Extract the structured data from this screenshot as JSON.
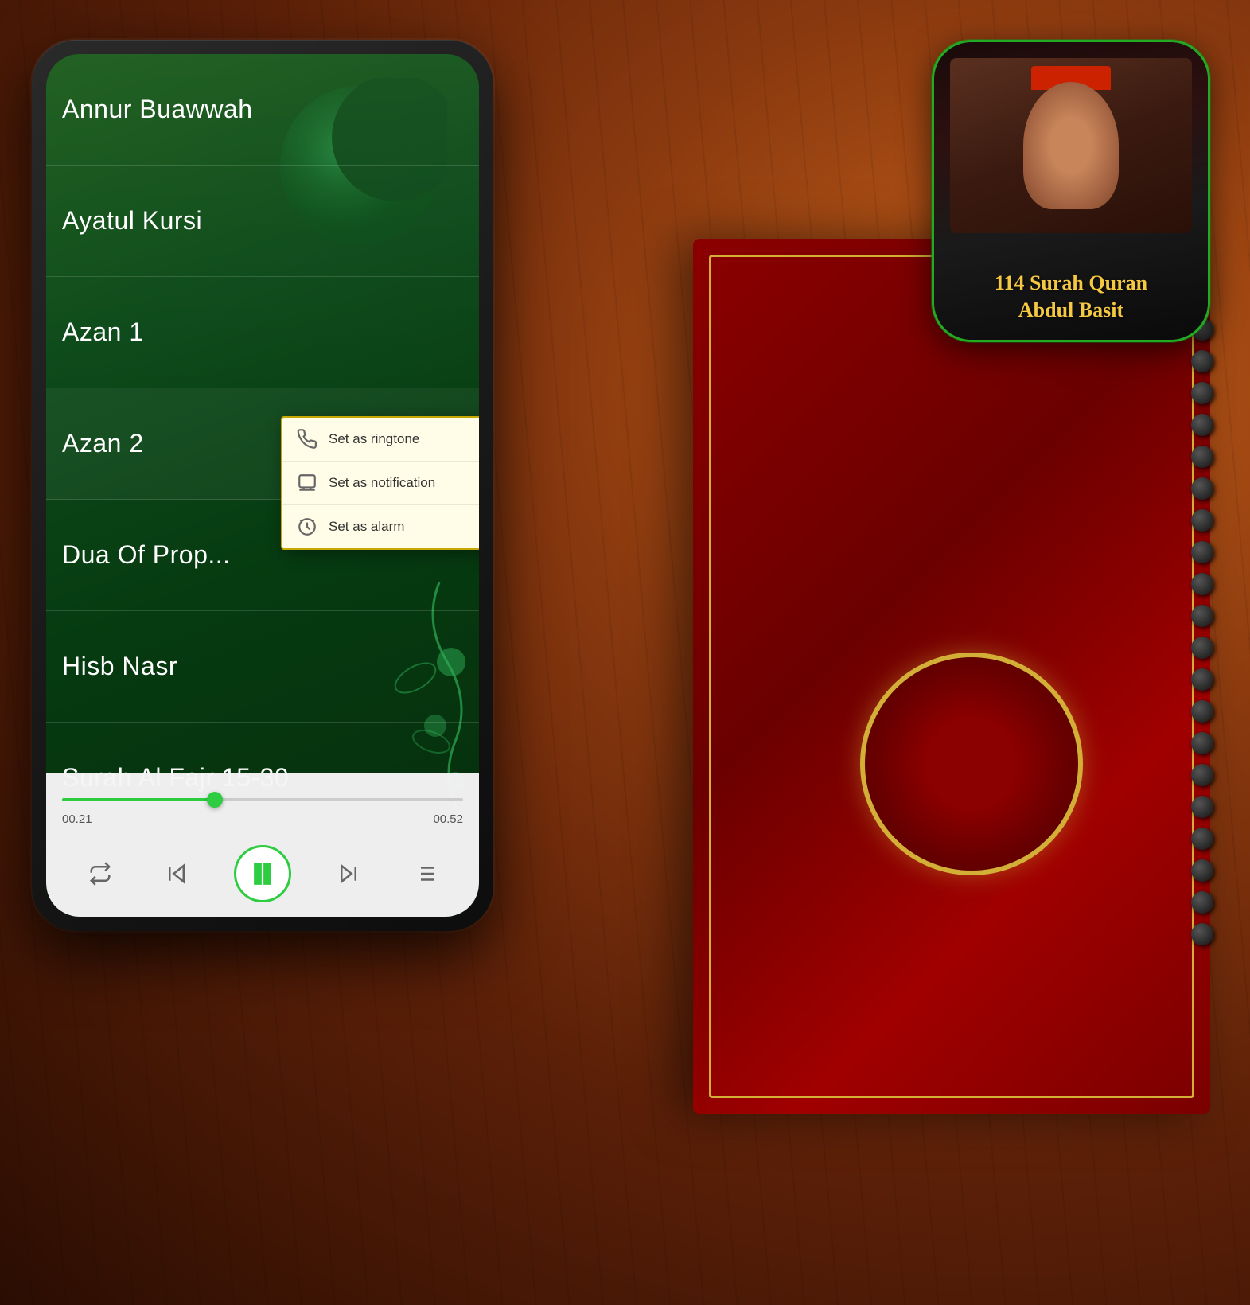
{
  "background": {
    "color": "#1a0a00"
  },
  "app_icon": {
    "title_line1": "114 Surah Quran",
    "title_line2": "Abdul Basit",
    "border_color": "#22cc22"
  },
  "phone": {
    "songs": [
      {
        "id": 1,
        "title": "Annur Buawwah"
      },
      {
        "id": 2,
        "title": "Ayatul Kursi"
      },
      {
        "id": 3,
        "title": "Azan 1"
      },
      {
        "id": 4,
        "title": "Azan 2"
      },
      {
        "id": 5,
        "title": "Dua Of Prop..."
      },
      {
        "id": 6,
        "title": "Hisb Nasr"
      },
      {
        "id": 7,
        "title": "Surah Al Fajr 15-30"
      }
    ],
    "context_menu": {
      "items": [
        {
          "id": "ringtone",
          "label": "Set as ringtone",
          "icon": "phone-icon"
        },
        {
          "id": "notification",
          "label": "Set as notification",
          "icon": "notification-icon"
        },
        {
          "id": "alarm",
          "label": "Set as alarm",
          "icon": "alarm-icon"
        }
      ]
    },
    "player": {
      "time_current": "00.21",
      "time_total": "00.52",
      "progress_percent": 38
    },
    "controls": {
      "repeat": "repeat-icon",
      "prev": "skip-back-icon",
      "play_pause": "pause-icon",
      "next": "skip-forward-icon",
      "playlist": "playlist-icon"
    }
  }
}
